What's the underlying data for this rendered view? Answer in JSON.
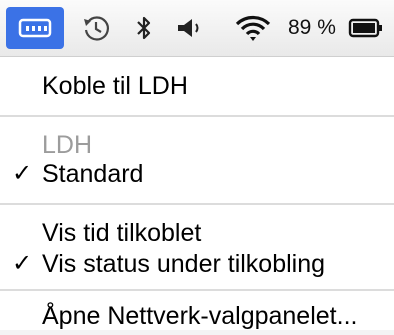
{
  "menubar": {
    "active_status_icon": "network-status-icon",
    "time_machine_icon": "time-machine-icon",
    "bluetooth_icon": "bluetooth-icon",
    "volume_icon": "speaker-volume-icon",
    "wifi_icon": "wifi-icon",
    "battery_percent": "89 %",
    "battery_icon": "battery-icon",
    "accent_color": "#3b72e6"
  },
  "menu": {
    "connect": "Koble til LDH",
    "section_header": "LDH",
    "standard": "Standard",
    "standard_checked": true,
    "show_time": "Vis tid tilkoblet",
    "show_status": "Vis status under tilkobling",
    "show_status_checked": true,
    "open_panel": "Åpne Nettverk-valgpanelet...",
    "checkmark": "✓"
  }
}
